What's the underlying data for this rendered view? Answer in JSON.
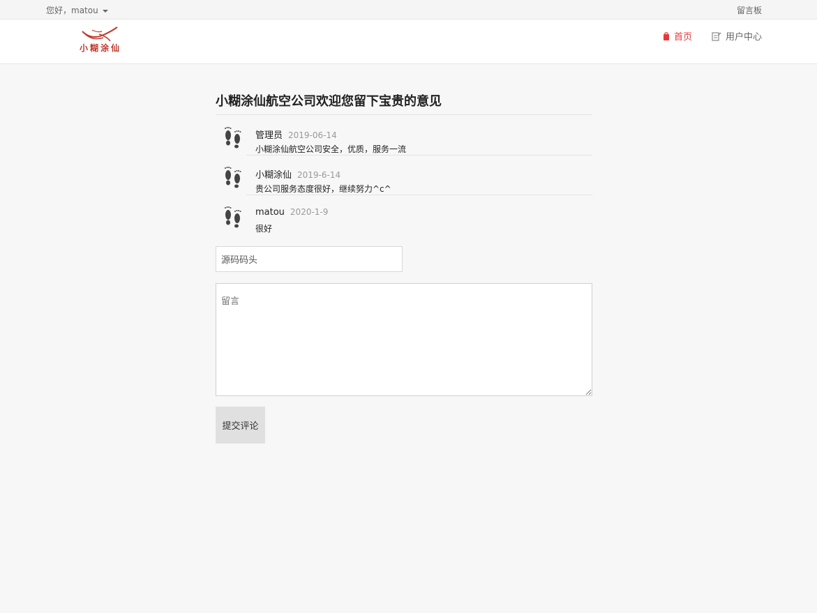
{
  "topbar": {
    "greeting": "您好，matou",
    "board_link": "留言板"
  },
  "header": {
    "logo_text": "小糊涂仙",
    "nav": [
      {
        "label": "首页",
        "icon": "bag-icon",
        "active": true
      },
      {
        "label": "用户中心",
        "icon": "edit-doc-icon",
        "active": false
      }
    ]
  },
  "main": {
    "title": "小糊涂仙航空公司欢迎您留下宝贵的意见",
    "comments": [
      {
        "author": "管理员",
        "date": "2019-06-14",
        "text": "小糊涂仙航空公司安全，优质，服务一流"
      },
      {
        "author": "小糊涂仙",
        "date": "2019-6-14",
        "text": "贵公司服务态度很好，继续努力^c^"
      },
      {
        "author": "matou",
        "date": "2020-1-9",
        "text": "很好"
      }
    ],
    "form": {
      "name_value": "源码码头",
      "message_placeholder": "留言",
      "submit_label": "提交评论"
    }
  },
  "colors": {
    "accent": "#e4393c",
    "background": "#f7f7f7",
    "button": "#e0e0e0"
  }
}
